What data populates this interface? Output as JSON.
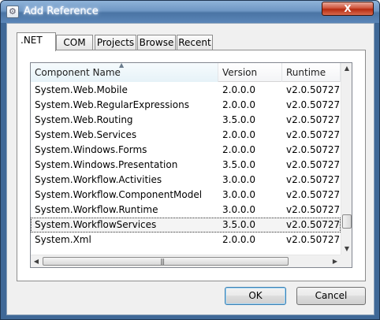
{
  "window": {
    "title": "Add Reference",
    "close_label": "X"
  },
  "tabs": [
    {
      "label": ".NET",
      "active": true
    },
    {
      "label": "COM",
      "active": false
    },
    {
      "label": "Projects",
      "active": false
    },
    {
      "label": "Browse",
      "active": false
    },
    {
      "label": "Recent",
      "active": false
    }
  ],
  "list": {
    "columns": [
      "Component Name",
      "Version",
      "Runtime"
    ],
    "sort_indicator": "▲",
    "rows": [
      [
        "System.Web.Mobile",
        "2.0.0.0",
        "v2.0.50727"
      ],
      [
        "System.Web.RegularExpressions",
        "2.0.0.0",
        "v2.0.50727"
      ],
      [
        "System.Web.Routing",
        "3.5.0.0",
        "v2.0.50727"
      ],
      [
        "System.Web.Services",
        "2.0.0.0",
        "v2.0.50727"
      ],
      [
        "System.Windows.Forms",
        "2.0.0.0",
        "v2.0.50727"
      ],
      [
        "System.Windows.Presentation",
        "3.5.0.0",
        "v2.0.50727"
      ],
      [
        "System.Workflow.Activities",
        "3.0.0.0",
        "v2.0.50727"
      ],
      [
        "System.Workflow.ComponentModel",
        "3.0.0.0",
        "v2.0.50727"
      ],
      [
        "System.Workflow.Runtime",
        "3.0.0.0",
        "v2.0.50727"
      ],
      [
        "System.WorkflowServices",
        "3.5.0.0",
        "v2.0.50727"
      ],
      [
        "System.Xml",
        "2.0.0.0",
        "v2.0.50727"
      ]
    ],
    "selected_row": 9
  },
  "scroll": {
    "up": "▲",
    "down": "▼",
    "left": "◀",
    "right": "▶",
    "grip": "|||"
  },
  "buttons": {
    "ok": "OK",
    "cancel": "Cancel"
  }
}
